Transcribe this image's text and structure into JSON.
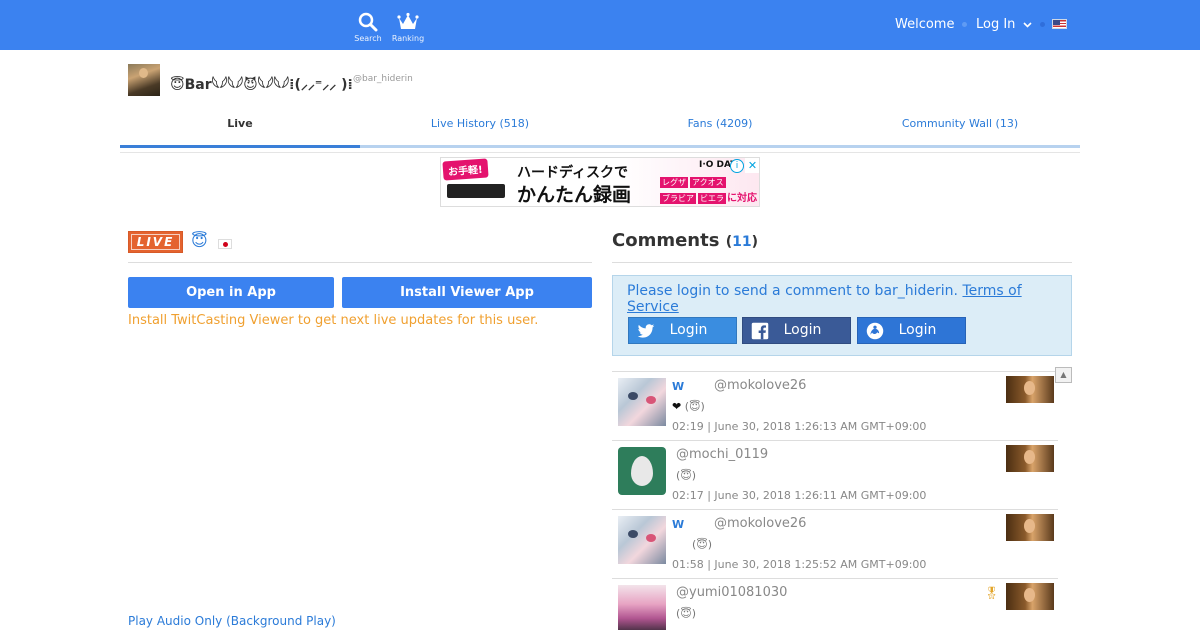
{
  "nav": {
    "search_label": "Search",
    "ranking_label": "Ranking",
    "welcome": "Welcome",
    "login": "Log In",
    "brand_color": "#3b82f0"
  },
  "profile": {
    "name": "😇Bar𓆩𓆪𓆩𓆪😈𓆩𓆪𓆩𓆪⁞(⸝⸝⁼⸝⸝ )⁞",
    "handle": "@bar_hiderin"
  },
  "tabs": [
    {
      "label": "Live"
    },
    {
      "label": "Live History (518)"
    },
    {
      "label": "Fans (4209)"
    },
    {
      "label": "Community Wall (13)"
    }
  ],
  "ad": {
    "badge": "お手軽!",
    "line1": "ハードディスクで",
    "line2": "かんたん録画",
    "brand": "I·O DATA",
    "tags": [
      "レグザ",
      "アクオス",
      "ブラビア",
      "ビエラ"
    ],
    "tag_suffix": "に対応",
    "info": "i",
    "close": "✕"
  },
  "live": {
    "badge": "LIVE",
    "halo_icon": "😇",
    "open_in_app": "Open in App",
    "install_viewer": "Install Viewer App",
    "install_note": "Install TwitCasting Viewer to get next live updates for this user.",
    "audio_only": "Play Audio Only (Background Play)"
  },
  "comments": {
    "title": "Comments",
    "count_open": "(",
    "count": "11",
    "count_close": ")",
    "login_msg": "Please login to send a comment to bar_hiderin.",
    "terms": "Terms of Service",
    "login_twitter": "Login",
    "login_facebook": "Login",
    "login_twitcasting": "Login",
    "scroll_icon": "▲",
    "items": [
      {
        "w": "W",
        "user": "@mokolove26",
        "heart": "❤",
        "text": "(😇)",
        "time": "02:19 | June 30, 2018 1:26:13 AM GMT+09:00"
      },
      {
        "w": "",
        "user": "@mochi_0119",
        "heart": "",
        "text": "(😇)",
        "time": "02:17 | June 30, 2018 1:26:11 AM GMT+09:00"
      },
      {
        "w": "W",
        "user": "@mokolove26",
        "heart": "",
        "text": "(😇)",
        "time": "01:58 | June 30, 2018 1:25:52 AM GMT+09:00"
      },
      {
        "w": "",
        "user": "@yumi01081030",
        "heart": "",
        "text": "(😇)",
        "time": "",
        "medal": "🎖"
      }
    ]
  }
}
